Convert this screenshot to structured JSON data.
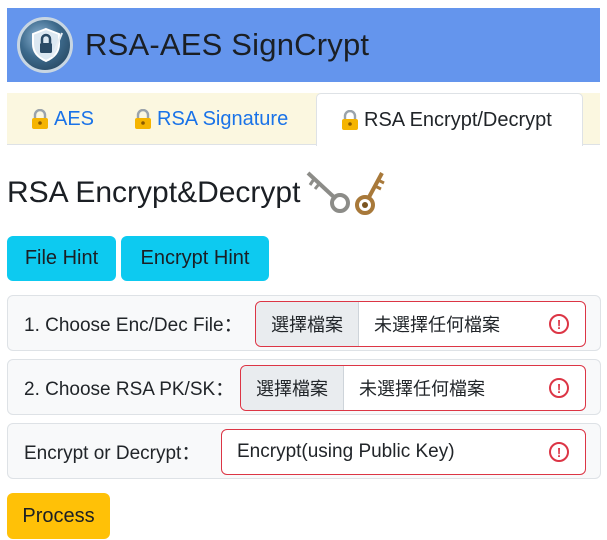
{
  "header": {
    "title": "RSA-AES SignCrypt",
    "logo": "shield-lock-logo"
  },
  "tabs": [
    {
      "label": "AES",
      "icon": "lock-icon",
      "active": false
    },
    {
      "label": "RSA Signature",
      "icon": "lock-icon",
      "active": false
    },
    {
      "label": "RSA Encrypt/Decrypt",
      "icon": "lock-icon",
      "active": true
    }
  ],
  "section": {
    "title": "RSA Encrypt&Decrypt",
    "icon": "keys-icon"
  },
  "hints": {
    "file_hint": "File Hint",
    "encrypt_hint": "Encrypt Hint"
  },
  "form": {
    "file": {
      "label": "1. Choose Enc/Dec File：",
      "button": "選擇檔案",
      "status": "未選擇任何檔案"
    },
    "key": {
      "label": "2. Choose RSA PK/SK：",
      "button": "選擇檔案",
      "status": "未選擇任何檔案"
    },
    "mode": {
      "label": "Encrypt or Decrypt：",
      "selected": "Encrypt(using Public Key)"
    }
  },
  "process_label": "Process",
  "colors": {
    "header_bg": "#6495ed",
    "tabs_bg": "#fbf7e0",
    "hint_button": "#0dcaf0",
    "process_button": "#ffc107",
    "invalid_border": "#dc3545",
    "link": "#1a73e8"
  }
}
